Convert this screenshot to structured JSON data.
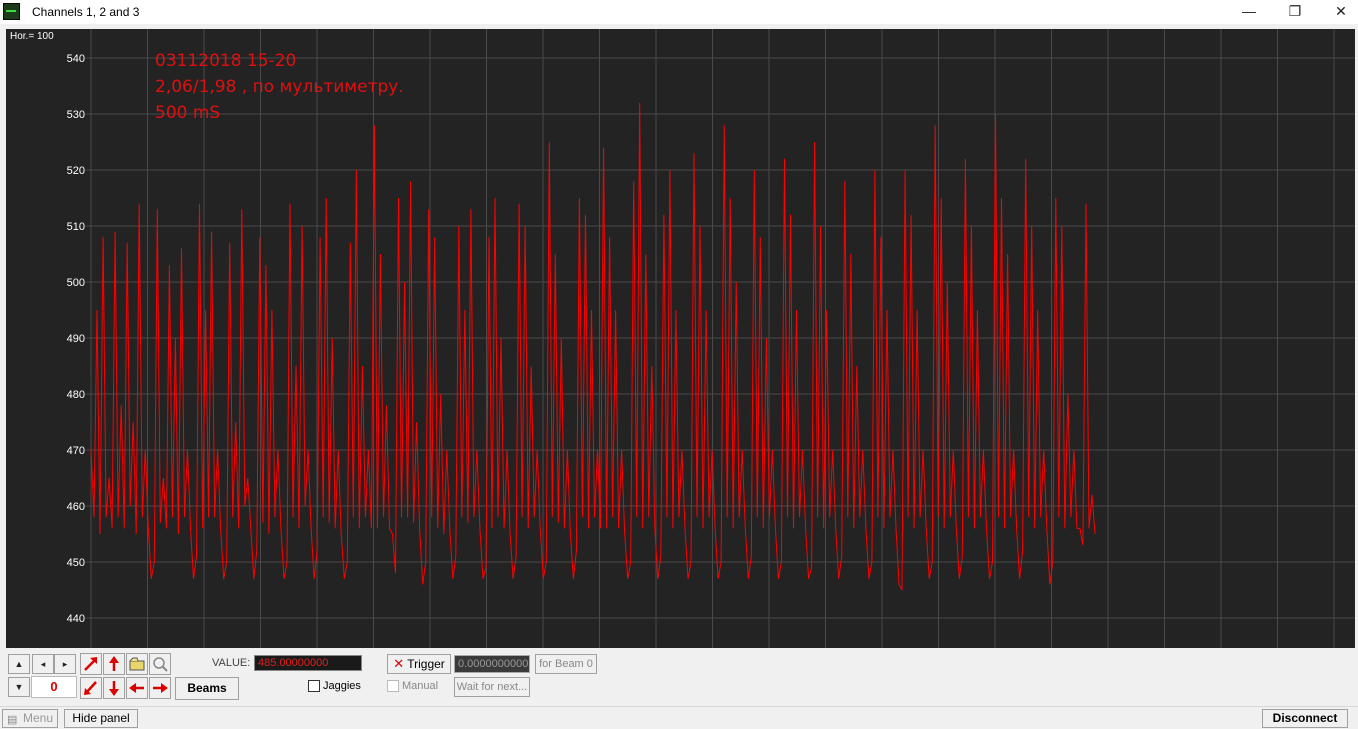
{
  "window": {
    "title": "Channels 1, 2 and 3",
    "minimize_glyph": "—",
    "maximize_glyph": "❐",
    "close_glyph": "✕"
  },
  "plot": {
    "hor_label": "Hor.= 100",
    "annotation_lines": [
      "03112018 15-20",
      "2,06/1,98  , по мультиметру.",
      "500 mS"
    ],
    "background_color": "#232323",
    "grid_color": "#4a4a4a",
    "trace_color": "#ff0000",
    "annotation_color": "#e01010"
  },
  "chart_data": {
    "type": "line",
    "title": "",
    "xlabel": "",
    "ylabel": "",
    "ylim": [
      436,
      545
    ],
    "y_ticks": [
      540,
      530,
      520,
      510,
      500,
      490,
      480,
      470,
      460,
      450,
      440
    ],
    "grid": true,
    "series": [
      {
        "values": [
          470,
          458,
          495,
          455,
          508,
          458,
          465,
          456,
          509,
          458,
          478,
          456,
          507,
          460,
          475,
          455,
          514,
          458,
          470,
          456,
          447,
          450,
          513,
          457,
          465,
          456,
          503,
          458,
          490,
          455,
          506,
          458,
          470,
          456,
          447,
          451,
          514,
          456,
          495,
          458,
          509,
          458,
          470,
          456,
          447,
          450,
          507,
          458,
          475,
          456,
          513,
          460,
          465,
          456,
          447,
          452,
          508,
          457,
          503,
          455,
          495,
          458,
          470,
          456,
          447,
          450,
          514,
          458,
          485,
          456,
          510,
          460,
          470,
          456,
          447,
          452,
          508,
          458,
          515,
          457,
          490,
          456,
          470,
          455,
          447,
          450,
          507,
          458,
          520,
          456,
          485,
          458,
          470,
          456,
          528,
          456,
          505,
          458,
          478,
          456,
          455,
          448,
          515,
          458,
          500,
          458,
          518,
          457,
          475,
          456,
          446,
          450,
          513,
          458,
          508,
          456,
          480,
          455,
          470,
          456,
          447,
          451,
          510,
          458,
          495,
          457,
          513,
          458,
          470,
          456,
          447,
          449,
          508,
          456,
          515,
          458,
          490,
          456,
          470,
          455,
          447,
          451,
          514,
          458,
          510,
          456,
          485,
          458,
          470,
          456,
          447,
          450,
          525,
          458,
          505,
          457,
          490,
          456,
          470,
          455,
          447,
          452,
          515,
          458,
          512,
          456,
          495,
          458,
          470,
          456,
          524,
          456,
          508,
          458,
          495,
          456,
          470,
          455,
          447,
          450,
          518,
          458,
          532,
          456,
          505,
          458,
          485,
          456,
          447,
          451,
          512,
          458,
          520,
          456,
          495,
          458,
          470,
          456,
          447,
          450,
          523,
          458,
          510,
          456,
          495,
          458,
          470,
          456,
          447,
          450,
          528,
          458,
          515,
          456,
          500,
          458,
          470,
          456,
          447,
          451,
          520,
          458,
          508,
          456,
          490,
          458,
          470,
          456,
          447,
          450,
          522,
          458,
          512,
          456,
          495,
          458,
          470,
          456,
          447,
          449,
          525,
          458,
          510,
          456,
          495,
          458,
          470,
          456,
          447,
          451,
          518,
          458,
          505,
          456,
          485,
          458,
          470,
          456,
          447,
          450,
          520,
          458,
          508,
          456,
          495,
          458,
          470,
          456,
          446,
          445,
          520,
          458,
          512,
          456,
          495,
          458,
          470,
          456,
          447,
          450,
          528,
          458,
          515,
          456,
          500,
          458,
          470,
          456,
          447,
          451,
          522,
          458,
          510,
          456,
          495,
          458,
          470,
          456,
          447,
          450,
          530,
          458,
          515,
          456,
          505,
          458,
          470,
          456,
          447,
          452,
          522,
          458,
          510,
          456,
          495,
          458,
          470,
          456,
          446,
          450,
          515,
          458,
          510,
          456,
          480,
          458,
          470,
          456,
          456,
          453,
          514,
          456,
          462,
          455
        ]
      }
    ]
  },
  "controls": {
    "scroll_up": "▲",
    "scroll_down": "▼",
    "scroll_left": "◂",
    "scroll_right": "▸",
    "offset_value": "0",
    "value_label": "VALUE:",
    "value_field": "485.00000000",
    "beams_label": "Beams",
    "trigger_label": "Trigger",
    "trigger_value": "0.0000000000",
    "for_beam_label": "for Beam 0",
    "jaggies_label": "Jaggies",
    "manual_label": "Manual",
    "wait_label": "Wait for next..."
  },
  "bottom_bar": {
    "menu_label": "Menu",
    "hide_panel_label": "Hide panel",
    "disconnect_label": "Disconnect"
  }
}
